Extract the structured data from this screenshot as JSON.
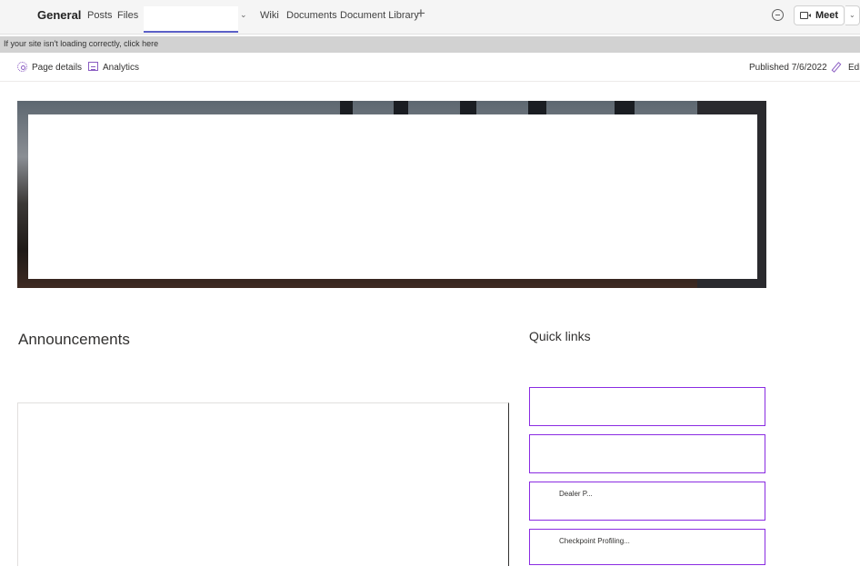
{
  "tabbar": {
    "channel": "General",
    "tabs": [
      "Posts",
      "Files",
      "Wiki",
      "Documents",
      "Document Library"
    ],
    "add_icon": "plus-icon",
    "chat_icon": "chat-icon",
    "meet_label": "Meet"
  },
  "notice": {
    "text": "If your site isn't loading correctly, click here"
  },
  "commandbar": {
    "page_details": "Page details",
    "analytics": "Analytics",
    "published": "Published 7/6/2022",
    "edit": "Edi"
  },
  "announcements": {
    "title": "Announcements"
  },
  "quick_links": {
    "title": "Quick links",
    "items": [
      "",
      "",
      "Dealer P...",
      "Checkpoint Profiling..."
    ]
  },
  "colors": {
    "accent": "#5b5fc7",
    "link_border": "#8a2be2",
    "icon": "#8a5cc2"
  }
}
